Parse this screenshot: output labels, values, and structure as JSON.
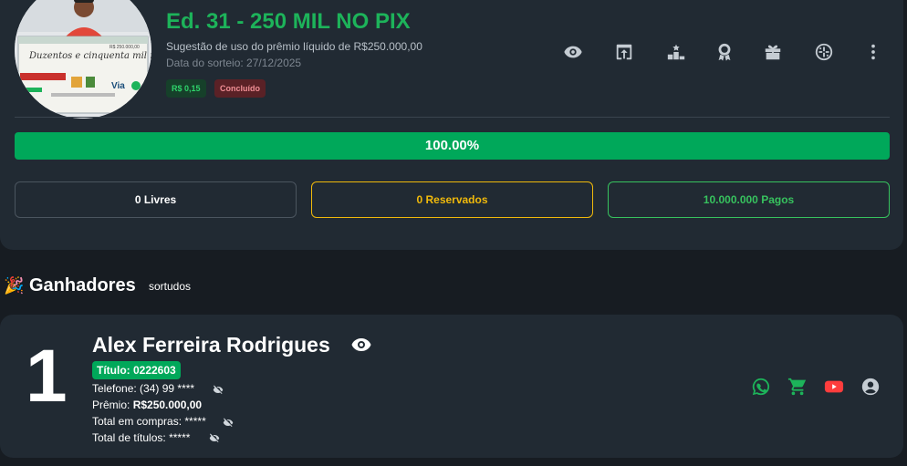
{
  "raffle": {
    "title": "Ed. 31 - 250 MIL NO PIX",
    "subtitle": "Sugestão de uso do prêmio líquido de R$250.000,00",
    "draw_date": "Data do sorteio: 27/12/2025",
    "price_badge": "R$ 0,15",
    "status_badge": "Concluído",
    "avatar_text": {
      "headline": "Duzentos e cinquenta mil reais",
      "amount": "R$ 250.000,00",
      "via": "Via"
    }
  },
  "toolbar": {
    "icons": [
      "eye-icon",
      "share-icon",
      "podium-icon",
      "award-icon",
      "gift-icon",
      "wheel-icon",
      "more-vertical-icon"
    ]
  },
  "progress": {
    "label": "100.00%",
    "percent": 100
  },
  "stats": {
    "free": "0 Livres",
    "reserved": "0 Reservados",
    "paid": "10.000.000 Pagos"
  },
  "winners_section": {
    "emoji": "🎉",
    "title": "Ganhadores",
    "subtitle": "sortudos"
  },
  "winner": {
    "rank": "1",
    "name": "Alex Ferreira Rodrigues",
    "ticket": "Título: 0222603",
    "phone_label": "Telefone:",
    "phone_value": "(34) 99 ****",
    "prize_label": "Prêmio:",
    "prize_value": "R$250.000,00",
    "purchases_label": "Total em compras:",
    "purchases_value": "*****",
    "titles_label": "Total de títulos:",
    "titles_value": "*****",
    "actions": [
      "whatsapp-icon",
      "cart-icon",
      "youtube-icon",
      "user-circle-icon"
    ]
  },
  "colors": {
    "accent_green": "#1db35a",
    "progress_green": "#00a85a",
    "reserved_yellow": "#f0b90b",
    "paid_green": "#37c25e",
    "youtube_red": "#ff3d3d",
    "card_bg": "#212a33",
    "page_bg": "#171c22"
  }
}
